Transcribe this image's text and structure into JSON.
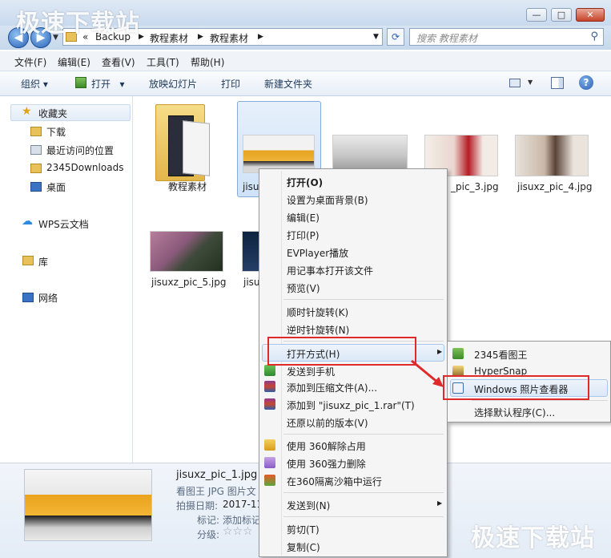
{
  "window": {
    "controls": {
      "minimize": "—",
      "maximize": "□",
      "close": "✕"
    }
  },
  "address": {
    "prefix": "«",
    "segments": [
      "Backup",
      "教程素材",
      "教程素材"
    ],
    "search_placeholder": "搜索 教程素材"
  },
  "menubar": [
    "文件(F)",
    "编辑(E)",
    "查看(V)",
    "工具(T)",
    "帮助(H)"
  ],
  "toolbar": {
    "organize": "组织",
    "open": "打开",
    "slideshow": "放映幻灯片",
    "print": "打印",
    "new_folder": "新建文件夹"
  },
  "navpane": {
    "favorites": "收藏夹",
    "favorites_items": [
      "下载",
      "最近访问的位置",
      "2345Downloads",
      "桌面"
    ],
    "wps": "WPS云文档",
    "library": "库",
    "network": "网络"
  },
  "files": [
    {
      "name": "教程素材"
    },
    {
      "name": "jisu"
    },
    {
      "name": ""
    },
    {
      "name": "_pic_3.jpg"
    },
    {
      "name": "jisuxz_pic_4.jpg"
    },
    {
      "name": "jisuxz_pic_5.jpg"
    },
    {
      "name": "jisu"
    }
  ],
  "context_menu": {
    "items": [
      "打开(O)",
      "设置为桌面背景(B)",
      "编辑(E)",
      "打印(P)",
      "EVPlayer播放",
      "用记事本打开该文件",
      "预览(V)",
      "顺时针旋转(K)",
      "逆时针旋转(N)",
      "打开方式(H)",
      "发送到手机",
      "添加到压缩文件(A)...",
      "添加到 \"jisuxz_pic_1.rar\"(T)",
      "还原以前的版本(V)",
      "使用 360解除占用",
      "使用 360强力删除",
      "在360隔离沙箱中运行",
      "发送到(N)",
      "剪切(T)",
      "复制(C)"
    ],
    "submenu_arrow": "▶"
  },
  "open_with_submenu": [
    "2345看图王",
    "HyperSnap",
    "Windows 照片查看器",
    "选择默认程序(C)..."
  ],
  "details": {
    "filename": "jisuxz_pic_1.jpg",
    "type": "看图王 JPG 图片文",
    "date_label": "拍摄日期:",
    "date_value": "2017-11",
    "tags_label": "标记:",
    "tags_value": "添加标记",
    "rating_label": "分级:",
    "rating_stars": "☆☆☆"
  },
  "watermark": "极速下载站",
  "colors": {
    "highlight_border": "#e02a2a",
    "menu_hover": "#dbe8f7"
  }
}
